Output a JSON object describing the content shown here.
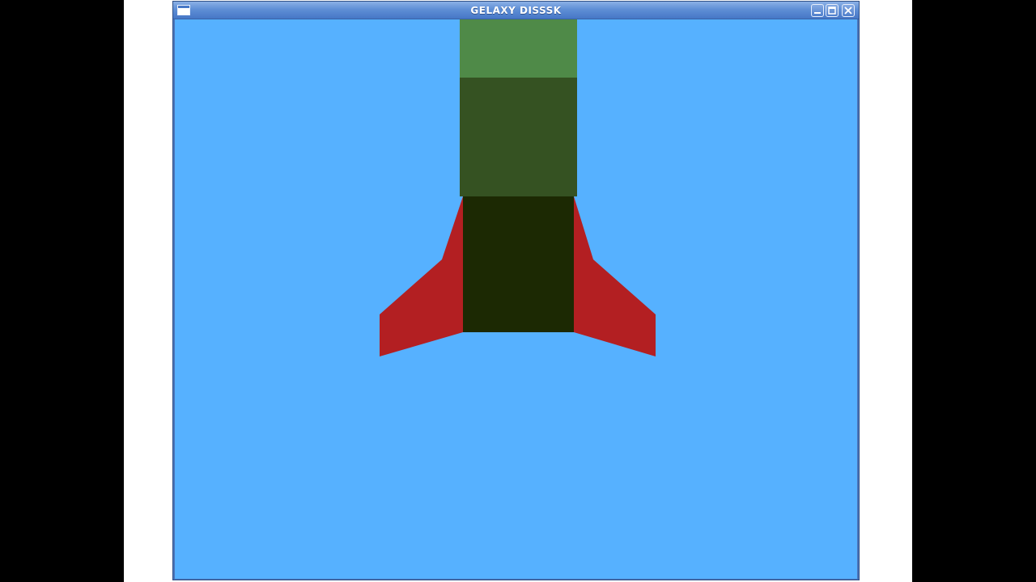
{
  "window": {
    "title": "GELAXY DISSSK"
  },
  "icons": {
    "menu": "window-menu-icon",
    "minimize": "minimize-icon",
    "maximize": "maximize-icon",
    "close": "close-icon"
  },
  "colors": {
    "sky": "#56b1ff",
    "rocket_nose": "#4f8a48",
    "rocket_mid": "#355222",
    "rocket_base": "#1c2903",
    "fins": "#b31f22",
    "titlebar": "#5f8fd6"
  }
}
